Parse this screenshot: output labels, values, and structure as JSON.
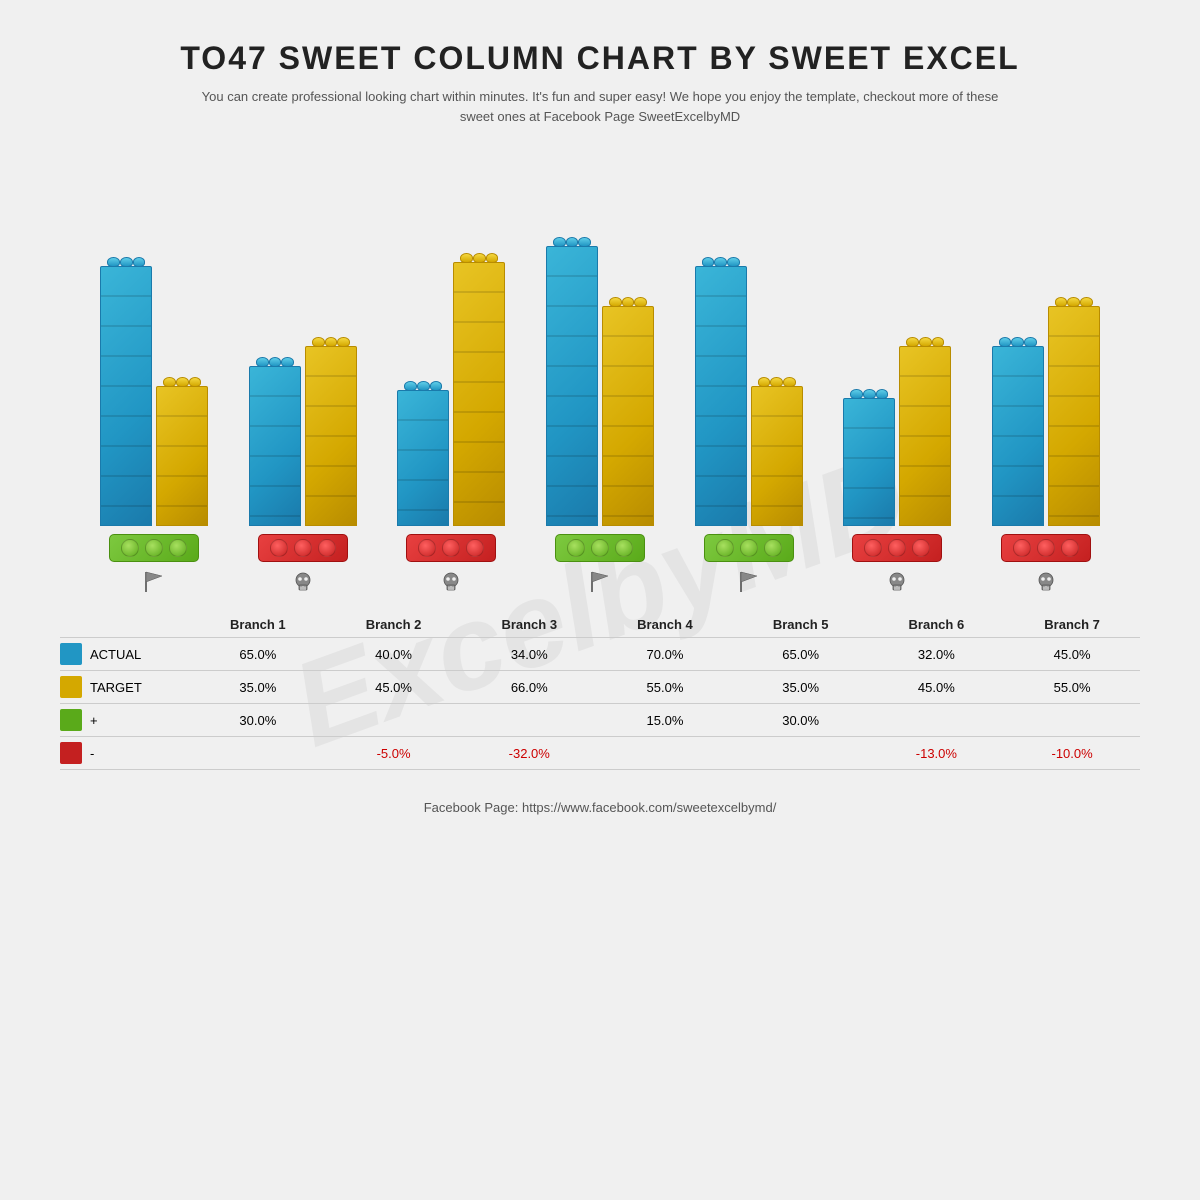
{
  "title": "TO47 SWEET COLUMN CHART BY SWEET EXCEL",
  "subtitle": "You can create professional looking chart within minutes. It's fun and super easy! We hope you enjoy the template, checkout more of these sweet ones at Facebook Page SweetExcelbyMD",
  "watermark": "ExcelbyMD",
  "colors": {
    "blue": "#2196c4",
    "yellow": "#d4a800",
    "green": "#5aaa1a",
    "red": "#c42020"
  },
  "branches": [
    {
      "name": "Branch 1",
      "actual": 65,
      "target": 35,
      "plus": 30,
      "minus": null,
      "indicator": "green",
      "icon": "flag"
    },
    {
      "name": "Branch 2",
      "actual": 40,
      "target": 45,
      "plus": null,
      "minus": -5,
      "indicator": "red",
      "icon": "skull"
    },
    {
      "name": "Branch 3",
      "actual": 34,
      "target": 66,
      "plus": null,
      "minus": -32,
      "indicator": "red",
      "icon": "skull"
    },
    {
      "name": "Branch 4",
      "actual": 70,
      "target": 55,
      "plus": 15,
      "minus": null,
      "indicator": "green",
      "icon": "flag"
    },
    {
      "name": "Branch 5",
      "actual": 65,
      "target": 35,
      "plus": 30,
      "minus": null,
      "indicator": "green",
      "icon": "flag"
    },
    {
      "name": "Branch 6",
      "actual": 32,
      "target": 45,
      "plus": null,
      "minus": -13,
      "indicator": "red",
      "icon": "skull"
    },
    {
      "name": "Branch 7",
      "actual": 45,
      "target": 55,
      "plus": null,
      "minus": -10,
      "indicator": "red",
      "icon": "skull"
    }
  ],
  "legend": {
    "actual_label": "ACTUAL",
    "target_label": "TARGET",
    "plus_label": "+",
    "minus_label": "-"
  },
  "footer": "Facebook Page: https://www.facebook.com/sweetexcelbymd/"
}
